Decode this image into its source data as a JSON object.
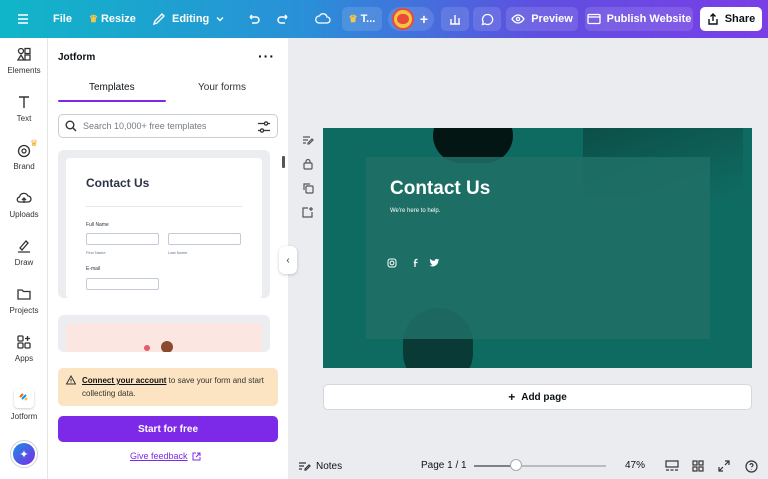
{
  "topbar": {
    "file_label": "File",
    "resize_label": "Resize",
    "editing_label": "Editing",
    "teams_label": "T...",
    "preview_label": "Preview",
    "publish_label": "Publish Website",
    "share_label": "Share"
  },
  "rail": {
    "items": [
      {
        "label": "Elements"
      },
      {
        "label": "Text"
      },
      {
        "label": "Brand"
      },
      {
        "label": "Uploads"
      },
      {
        "label": "Draw"
      },
      {
        "label": "Projects"
      },
      {
        "label": "Apps"
      },
      {
        "label": "Jotform"
      }
    ]
  },
  "panel": {
    "title": "Jotform",
    "tabs": [
      {
        "label": "Templates",
        "active": true
      },
      {
        "label": "Your forms",
        "active": false
      }
    ],
    "search_placeholder": "Search 10,000+ free templates",
    "template_card": {
      "title": "Contact Us",
      "full_name_label": "Full Name",
      "first_name_label": "First Name",
      "last_name_label": "Last Name",
      "email_label": "E-mail"
    },
    "notice": {
      "link_text": "Connect your account",
      "text": " to save your form and start collecting data."
    },
    "start_button": "Start for free",
    "feedback_link": "Give feedback"
  },
  "design": {
    "title": "Contact Us",
    "subtitle": "We're here to help.",
    "accent": "#0e6b61"
  },
  "canvas": {
    "add_page_label": "Add page"
  },
  "bottombar": {
    "notes_label": "Notes",
    "page_label": "Page 1 / 1",
    "zoom_label": "47%",
    "zoom_value": 0.47
  },
  "colors": {
    "brand_purple": "#7d2ae8",
    "notice_bg": "#fce3c2"
  }
}
